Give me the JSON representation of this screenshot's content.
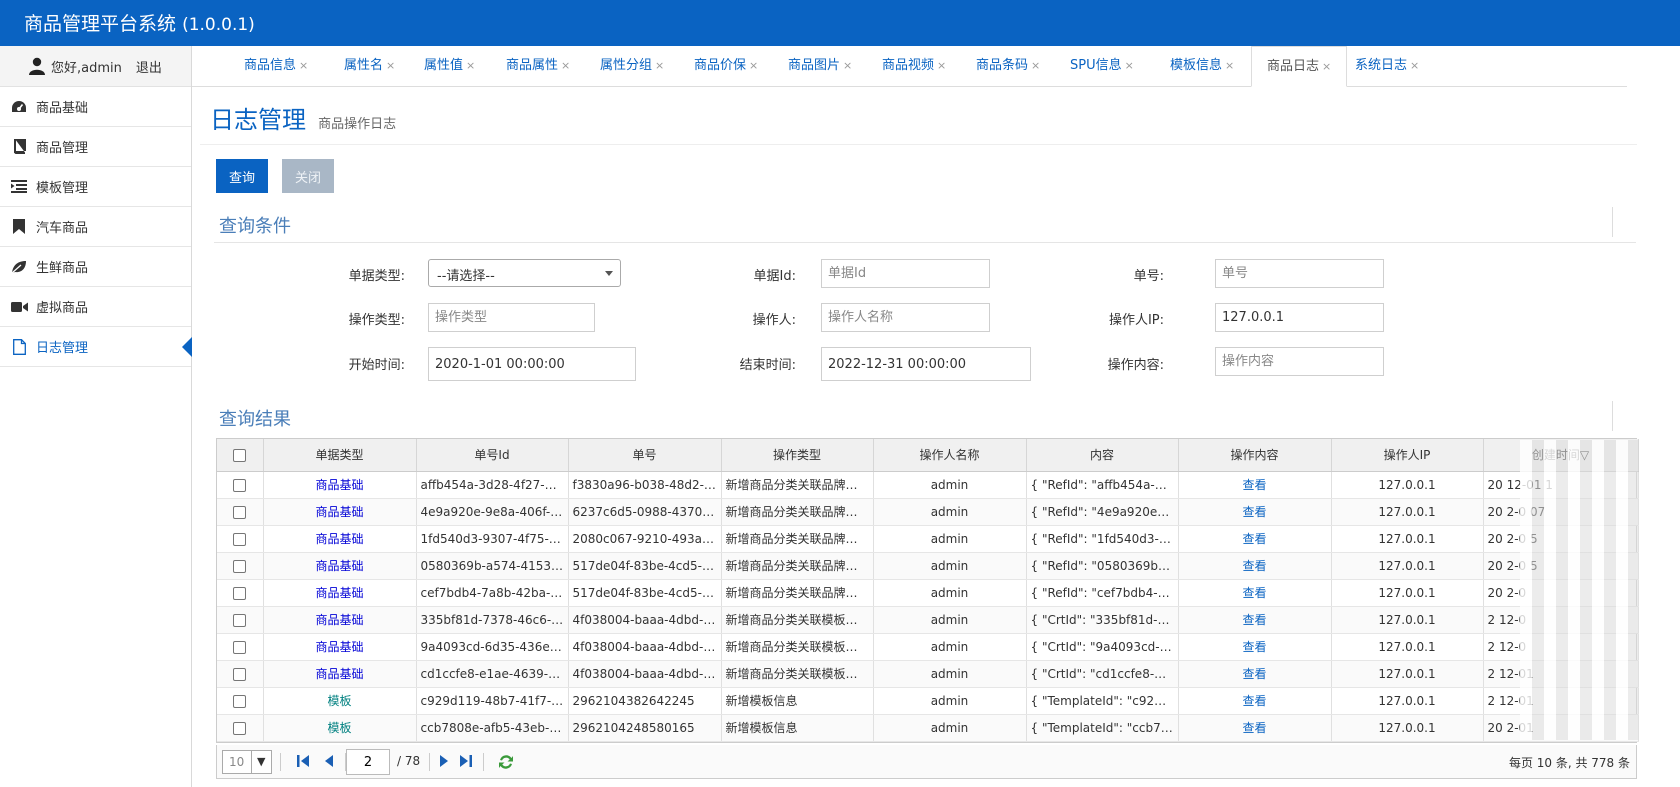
{
  "header": {
    "title": "商品管理平台系统",
    "version": "(1.0.0.1)"
  },
  "sidebar": {
    "greeting": "您好,admin",
    "logout": "退出",
    "items": [
      {
        "label": "商品基础",
        "icon": "dashboard-icon"
      },
      {
        "label": "商品管理",
        "icon": "book-icon"
      },
      {
        "label": "模板管理",
        "icon": "list-indent-icon"
      },
      {
        "label": "汽车商品",
        "icon": "bookmark-icon"
      },
      {
        "label": "生鲜商品",
        "icon": "leaf-icon"
      },
      {
        "label": "虚拟商品",
        "icon": "video-camera-icon"
      },
      {
        "label": "日志管理",
        "icon": "file-icon"
      }
    ],
    "active_index": 6
  },
  "tabs": [
    "商品信息",
    "属性名",
    "属性值",
    "商品属性",
    "属性分组",
    "商品价保",
    "商品图片",
    "商品视频",
    "商品条码",
    "SPU信息",
    "模板信息",
    "商品日志",
    "系统日志"
  ],
  "active_tab": 11,
  "page": {
    "title": "日志管理",
    "subtitle": "商品操作日志"
  },
  "toolbar": {
    "query_label": "查询",
    "close_label": "关闭"
  },
  "query": {
    "section_title": "查询条件",
    "doc_type_label": "单据类型:",
    "doc_type_value": "--请选择--",
    "doc_id_label": "单据Id:",
    "doc_id_placeholder": "单据Id",
    "doc_no_label": "单号:",
    "doc_no_placeholder": "单号",
    "op_type_label": "操作类型:",
    "op_type_placeholder": "操作类型",
    "operator_label": "操作人:",
    "operator_placeholder": "操作人名称",
    "operator_ip_label": "操作人IP:",
    "operator_ip_value": "127.0.0.1",
    "start_label": "开始时间:",
    "start_value": "2020-1-01 00:00:00",
    "end_label": "结束时间:",
    "end_value": "2022-12-31 00:00:00",
    "content_label": "操作内容:",
    "content_placeholder": "操作内容"
  },
  "results": {
    "section_title": "查询结果",
    "columns": [
      "单据类型",
      "单号Id",
      "单号",
      "操作类型",
      "操作人名称",
      "内容",
      "操作内容",
      "操作人IP",
      "创建时间"
    ],
    "sort_indicator": "▽",
    "rows": [
      {
        "type": "商品基础",
        "type_kind": "base",
        "id": "affb454a-3d28-4f27-bfdc...",
        "no": "f3830a96-b038-48d2-a8...",
        "op": "新增商品分类关联品牌信...",
        "user": "admin",
        "content": "{ \"RefId\": \"affb454a-3d2...",
        "view": "查看",
        "ip": "127.0.0.1",
        "created": "20  12-01  1"
      },
      {
        "type": "商品基础",
        "type_kind": "base",
        "id": "4e9a920e-9e8a-406f-8dd...",
        "no": "6237c6d5-0988-4370-99...",
        "op": "新增商品分类关联品牌信...",
        "user": "admin",
        "content": "{ \"RefId\": \"4e9a920e-9e...",
        "view": "查看",
        "ip": "127.0.0.1",
        "created": "20  2-0  07"
      },
      {
        "type": "商品基础",
        "type_kind": "base",
        "id": "1fd540d3-9307-4f75-897...",
        "no": "2080c067-9210-493a-bd...",
        "op": "新增商品分类关联品牌信...",
        "user": "admin",
        "content": "{ \"RefId\": \"1fd540d3-93...",
        "view": "查看",
        "ip": "127.0.0.1",
        "created": "20  2-0  5"
      },
      {
        "type": "商品基础",
        "type_kind": "base",
        "id": "0580369b-a574-4153-8e...",
        "no": "517de04f-83be-4cd5-96e...",
        "op": "新增商品分类关联品牌信...",
        "user": "admin",
        "content": "{ \"RefId\": \"0580369b-a5...",
        "view": "查看",
        "ip": "127.0.0.1",
        "created": "20  2-0  5"
      },
      {
        "type": "商品基础",
        "type_kind": "base",
        "id": "cef7bdb4-7a8b-42ba-8ef...",
        "no": "517de04f-83be-4cd5-96e...",
        "op": "新增商品分类关联品牌信...",
        "user": "admin",
        "content": "{ \"RefId\": \"cef7bdb4-7a8...",
        "view": "查看",
        "ip": "127.0.0.1",
        "created": "20  2-0"
      },
      {
        "type": "商品基础",
        "type_kind": "base",
        "id": "335bf81d-7378-46c6-94...",
        "no": "4f038004-baaa-4dbd-86...",
        "op": "新增商品分类关联模板信...",
        "user": "admin",
        "content": "{ \"CrtId\": \"335bf81d-737...",
        "view": "查看",
        "ip": "127.0.0.1",
        "created": "2  12-0"
      },
      {
        "type": "商品基础",
        "type_kind": "base",
        "id": "9a4093cd-6d35-436e-ba...",
        "no": "4f038004-baaa-4dbd-86...",
        "op": "新增商品分类关联模板信...",
        "user": "admin",
        "content": "{ \"CrtId\": \"9a4093cd-6d...",
        "view": "查看",
        "ip": "127.0.0.1",
        "created": "2  12-0"
      },
      {
        "type": "商品基础",
        "type_kind": "base",
        "id": "cd1ccfe8-e1ae-4639-811...",
        "no": "4f038004-baaa-4dbd-86...",
        "op": "新增商品分类关联模板信...",
        "user": "admin",
        "content": "{ \"CrtId\": \"cd1ccfe8-e1a...",
        "view": "查看",
        "ip": "127.0.0.1",
        "created": "2  12-01"
      },
      {
        "type": "模板",
        "type_kind": "tpl",
        "id": "c929d119-48b7-41f7-83...",
        "no": "2962104382642245",
        "op": "新增模板信息",
        "user": "admin",
        "content": "{ \"TemplateId\": \"c929d1...",
        "view": "查看",
        "ip": "127.0.0.1",
        "created": "2  12-01"
      },
      {
        "type": "模板",
        "type_kind": "tpl",
        "id": "ccb7808e-afb5-43eb-8be...",
        "no": "2962104248580165",
        "op": "新增模板信息",
        "user": "admin",
        "content": "{ \"TemplateId\": \"ccb780...",
        "view": "查看",
        "ip": "127.0.0.1",
        "created": "20  2-01"
      }
    ]
  },
  "pager": {
    "page_size": "10",
    "current_page": "2",
    "total_pages": "/ 78",
    "info": "每页 10 条, 共 778 条"
  }
}
